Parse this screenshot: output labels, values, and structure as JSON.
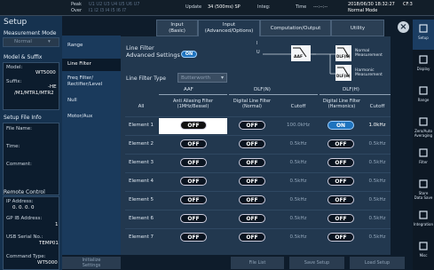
{
  "topbar": {
    "peak_label": "Peak",
    "over_label": "Over",
    "update_label": "Update",
    "update_value": "34 (500ms) SP",
    "integ_label": "Integ:",
    "time_label": "Time",
    "time_value": "---:--:--",
    "date": "2018/06/30 18:32:27",
    "cf": "CF:3",
    "mode": "Normal Mode"
  },
  "left": {
    "title": "Setup",
    "measurement_mode": "Measurement Mode",
    "mode_value": "Normal",
    "model_suffix": "Model & Suffix",
    "model_label": "Model:",
    "model_value": "WT5000",
    "suffix_label": "Suffix:",
    "suffix_value1": "-HE",
    "suffix_value2": "/M1/MTR1/MTR2",
    "setup_file_info": "Setup File Info",
    "file_name": "File Name:",
    "time": "Time:",
    "comment": "Comment:",
    "remote_control": "Remote Control",
    "ip_label": "IP Address:",
    "ip_value": "0.  0.  0.  0",
    "gpib_label": "GP IB Address:",
    "gpib_value": "1",
    "usb_label": "USB Serial No.:",
    "usb_value": "TEMP01",
    "cmd_label": "Command Type:",
    "cmd_value": "WT5000"
  },
  "nav": {
    "items": [
      "Range",
      "Line Filter",
      "Freq Filter/\nRectifier/Level",
      "Null",
      "Motor/Aux"
    ]
  },
  "tabs": [
    {
      "label": "Input\n(Basic)"
    },
    {
      "label": "Input\n(Advanced/Options)"
    },
    {
      "label": "Computation/Output"
    },
    {
      "label": "Utility"
    }
  ],
  "content": {
    "section_title": "Line Filter\nAdvanced Settings",
    "on_label": "ON",
    "type_label": "Line Filter Type",
    "type_value": "Butterworth",
    "diagram": {
      "i_label": "I",
      "u_label": "U",
      "aaf": "AAF",
      "dlf_n": "DLF(N)",
      "dlf_h": "DLF(H)",
      "normal": "Normal\nMeasurement",
      "harmonic": "Harmonic\nMeasurement"
    }
  },
  "table": {
    "headers": {
      "all": "All",
      "aaf": "AAF",
      "dlf_n": "DLF(N)",
      "dlf_h": "DLF(H)",
      "aaf_sub": "Anti Aliasing Filter\n(1MHz/Bessel)",
      "dlf_n_sub": "Digital Line Filter\n(Normal)",
      "cutoff": "Cutoff",
      "dlf_h_sub": "Digital Line Filter\n(Harmonics)",
      "cutoff2": "Cutoff"
    },
    "rows": [
      {
        "name": "Element 1",
        "aaf": "OFF",
        "dlfn": "OFF",
        "cut1": "100.0kHz",
        "dlfh": "ON",
        "cut2": "1.0kHz"
      },
      {
        "name": "Element 2",
        "aaf": "OFF",
        "dlfn": "OFF",
        "cut1": "0.5kHz",
        "dlfh": "OFF",
        "cut2": "0.5kHz"
      },
      {
        "name": "Element 3",
        "aaf": "OFF",
        "dlfn": "OFF",
        "cut1": "0.5kHz",
        "dlfh": "OFF",
        "cut2": "0.5kHz"
      },
      {
        "name": "Element 4",
        "aaf": "OFF",
        "dlfn": "OFF",
        "cut1": "0.5kHz",
        "dlfh": "OFF",
        "cut2": "0.5kHz"
      },
      {
        "name": "Element 5",
        "aaf": "OFF",
        "dlfn": "OFF",
        "cut1": "0.5kHz",
        "dlfh": "OFF",
        "cut2": "0.5kHz"
      },
      {
        "name": "Element 6",
        "aaf": "OFF",
        "dlfn": "OFF",
        "cut1": "0.5kHz",
        "dlfh": "OFF",
        "cut2": "0.5kHz"
      },
      {
        "name": "Element 7",
        "aaf": "OFF",
        "dlfn": "OFF",
        "cut1": "0.5kHz",
        "dlfh": "OFF",
        "cut2": "0.5kHz"
      }
    ]
  },
  "rightbar": [
    {
      "label": "Setup",
      "icon": "gear-icon"
    },
    {
      "label": "Display",
      "icon": "display-icon"
    },
    {
      "label": "Range",
      "icon": "range-icon"
    },
    {
      "label": "Zero/Auto\nAveraging",
      "icon": "refresh-icon"
    },
    {
      "label": "Filter",
      "icon": "filter-icon"
    },
    {
      "label": "Store\nData Save",
      "icon": "store-icon"
    },
    {
      "label": "Integration",
      "icon": "integration-icon"
    },
    {
      "label": "Misc",
      "icon": "misc-icon"
    }
  ],
  "bottom": {
    "initialize": "Initialize\nSettings",
    "file_list": "File List",
    "save_setup": "Save Setup",
    "load_setup": "Load Setup"
  }
}
